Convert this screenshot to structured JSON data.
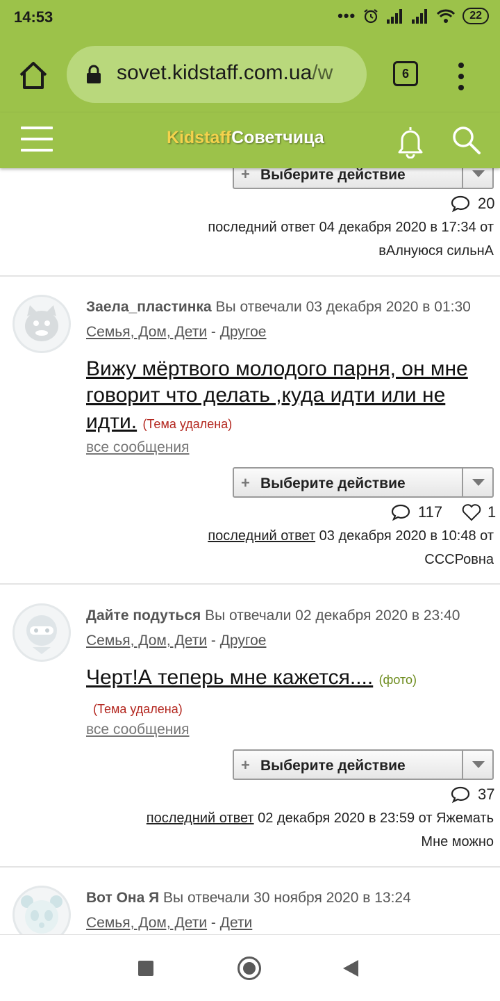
{
  "status_bar": {
    "time": "14:53",
    "battery": "22",
    "dots": "•••"
  },
  "browser": {
    "url_main": "sovet.kidstaff.com.ua",
    "url_rest": "/w",
    "tab_count": "6"
  },
  "site": {
    "logo_part1": "Kidstaff",
    "logo_part2": "Советчица"
  },
  "top_item": {
    "action_label": "Выберите действие",
    "comment_count": "20",
    "last_reply_line": "последний ответ 04 декабря 2020 в 17:34 от",
    "last_user": "вАлнуюся сильнА"
  },
  "posts": [
    {
      "author": "Заела_пластинка",
      "meta": " Вы отвечали 03 декабря 2020 в 01:30",
      "category": "Семья, Дом, Дети",
      "sep": " - ",
      "subcategory": "Другое",
      "title": "Вижу мёртвого молодого парня, он мне говорит что делать ,куда идти или не идти.",
      "deleted": "(Тема удалена)",
      "all_messages": "все сообщения",
      "action_label": "Выберите действие",
      "comment_count": "117",
      "like_count": "1",
      "last_reply_link": "последний ответ",
      "last_reply_rest": " 03 декабря 2020 в 10:48 от",
      "last_user": "СССРовна"
    },
    {
      "author": "Дайте подуться",
      "meta": " Вы отвечали 02 декабря 2020 в 23:40",
      "category": "Семья, Дом, Дети",
      "sep": " - ",
      "subcategory": "Другое",
      "title": "Черт!А теперь мне кажется....",
      "photo": "(фото)",
      "deleted": "(Тема удалена)",
      "all_messages": "все сообщения",
      "action_label": "Выберите действие",
      "comment_count": "37",
      "last_reply_link": "последний ответ",
      "last_reply_rest": " 02 декабря 2020 в 23:59 от Яжемать",
      "last_user": "Мне можно"
    },
    {
      "author": "Вот Она Я",
      "meta": " Вы отвечали 30 ноября 2020 в 13:24",
      "category": "Семья, Дом, Дети",
      "sep": " - ",
      "subcategory": "Дети"
    }
  ],
  "icons": {
    "home": "home-icon",
    "lock": "lock-icon",
    "menu": "more-vert-icon",
    "hamburger": "hamburger-icon",
    "bell": "bell-icon",
    "search": "search-icon",
    "comment": "comment-icon",
    "heart": "heart-icon"
  },
  "colors": {
    "brand_green": "#9cc24a",
    "logo_yellow": "#f4d24c",
    "deleted_red": "#b3261e",
    "photo_green": "#6b8a1a"
  }
}
